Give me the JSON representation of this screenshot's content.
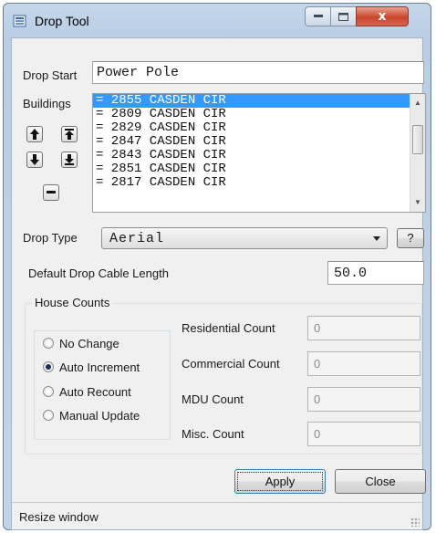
{
  "window": {
    "title": "Drop Tool",
    "close_glyph": "x"
  },
  "drop_start": {
    "label": "Drop Start",
    "value": "Power Pole"
  },
  "buildings": {
    "label": "Buildings",
    "items": [
      "= 2855 CASDEN CIR",
      "= 2809 CASDEN CIR",
      "= 2829 CASDEN CIR",
      "= 2847 CASDEN CIR",
      "= 2843 CASDEN CIR",
      "= 2851 CASDEN CIR",
      "= 2817 CASDEN CIR"
    ],
    "selected_index": 0,
    "icons": [
      "arrow-up-icon",
      "arrow-up-top-icon",
      "arrow-down-icon",
      "arrow-down-bottom-icon",
      "remove-icon"
    ]
  },
  "drop_type": {
    "label": "Drop Type",
    "value": "Aerial",
    "help_label": "?"
  },
  "cable_length": {
    "label": "Default Drop Cable Length",
    "value": "50.0"
  },
  "house_counts": {
    "title": "House Counts",
    "options": [
      "No Change",
      "Auto Increment",
      "Auto Recount",
      "Manual Update"
    ],
    "selected": "Auto Increment",
    "fields": [
      {
        "label": "Residential Count",
        "value": "0"
      },
      {
        "label": "Commercial Count",
        "value": "0"
      },
      {
        "label": "MDU Count",
        "value": "0"
      },
      {
        "label": "Misc. Count",
        "value": "0"
      }
    ]
  },
  "actions": {
    "apply_label": "Apply",
    "close_label": "Close"
  },
  "status": {
    "text": "Resize window"
  },
  "colors": {
    "selection": "#3399ff",
    "close_button": "#c8462d",
    "title_bar": "#b9cde4"
  }
}
